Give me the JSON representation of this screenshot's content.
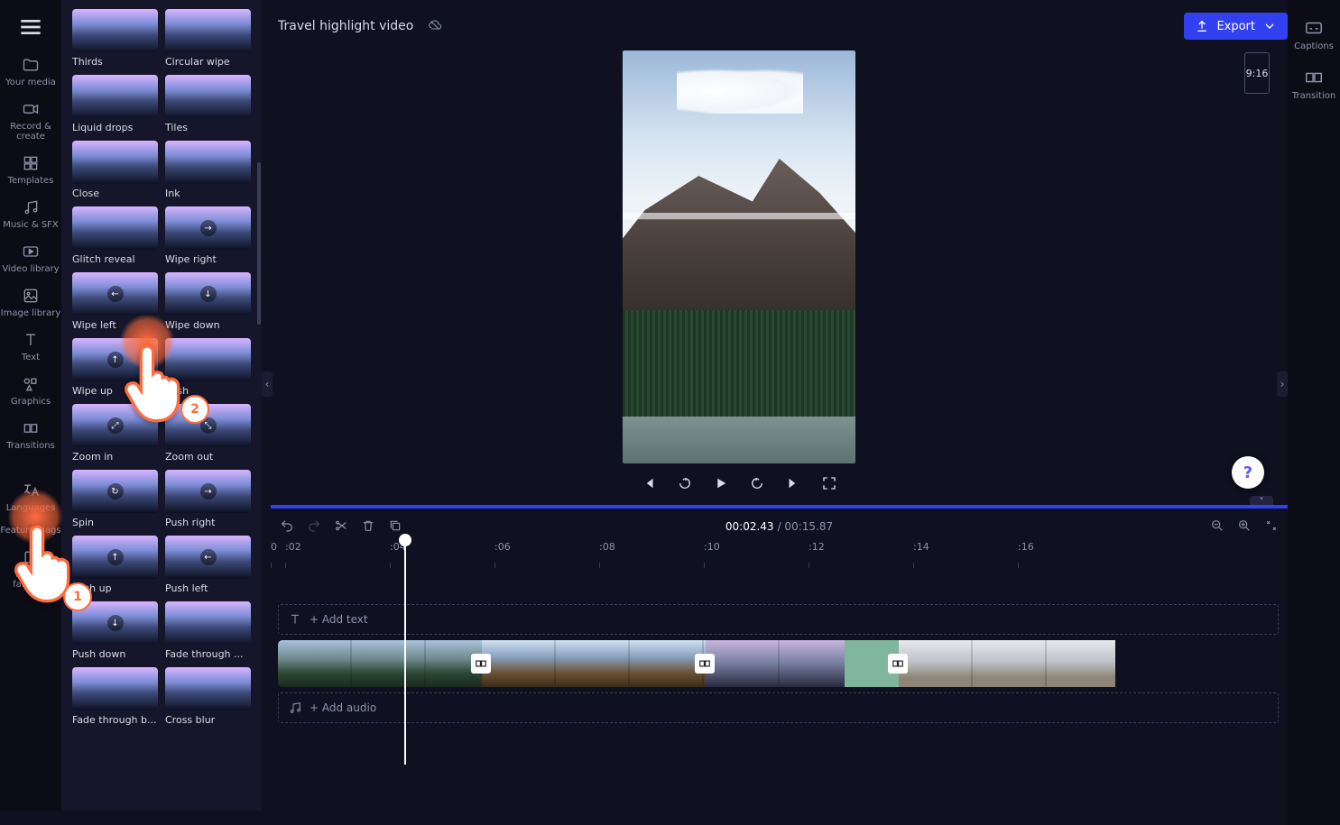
{
  "header": {
    "project_title": "Travel highlight video",
    "export_label": "Export",
    "aspect_ratio": "9:16"
  },
  "left_rail": [
    {
      "id": "your-media",
      "label": "Your media"
    },
    {
      "id": "record-create",
      "label": "Record & create"
    },
    {
      "id": "templates",
      "label": "Templates"
    },
    {
      "id": "music-sfx",
      "label": "Music & SFX"
    },
    {
      "id": "video-library",
      "label": "Video library"
    },
    {
      "id": "image-library",
      "label": "Image library"
    },
    {
      "id": "text",
      "label": "Text"
    },
    {
      "id": "graphics",
      "label": "Graphics"
    },
    {
      "id": "transitions",
      "label": "Transitions"
    },
    {
      "id": "languages",
      "label": "Languages"
    },
    {
      "id": "feature-flags",
      "label": "Feature Flags"
    },
    {
      "id": "version",
      "label": "Version fa9c5c6"
    }
  ],
  "right_rail": [
    {
      "id": "captions",
      "label": "Captions"
    },
    {
      "id": "transition",
      "label": "Transition"
    }
  ],
  "transitions_panel": {
    "items": [
      {
        "label": "Thirds",
        "dir": ""
      },
      {
        "label": "Circular wipe",
        "dir": ""
      },
      {
        "label": "Liquid drops",
        "dir": ""
      },
      {
        "label": "Tiles",
        "dir": ""
      },
      {
        "label": "Close",
        "dir": ""
      },
      {
        "label": "Ink",
        "dir": ""
      },
      {
        "label": "Glitch reveal",
        "dir": ""
      },
      {
        "label": "Wipe right",
        "dir": "→"
      },
      {
        "label": "Wipe left",
        "dir": "←"
      },
      {
        "label": "Wipe down",
        "dir": "↓"
      },
      {
        "label": "Wipe up",
        "dir": "↑"
      },
      {
        "label": "Push",
        "dir": ""
      },
      {
        "label": "Zoom in",
        "dir": "⤢"
      },
      {
        "label": "Zoom out",
        "dir": "⤡"
      },
      {
        "label": "Spin",
        "dir": "↻"
      },
      {
        "label": "Push right",
        "dir": "→"
      },
      {
        "label": "Push up",
        "dir": "↑"
      },
      {
        "label": "Push left",
        "dir": "←"
      },
      {
        "label": "Push down",
        "dir": "↓"
      },
      {
        "label": "Fade through ...",
        "dir": ""
      },
      {
        "label": "Fade through b...",
        "dir": ""
      },
      {
        "label": "Cross blur",
        "dir": ""
      }
    ]
  },
  "timeline": {
    "current_time": "00:02.43",
    "total_time": "00:15.87",
    "add_text": "+ Add text",
    "add_audio": "+ Add audio",
    "ruler": [
      "0",
      ":02",
      ":04",
      ":06",
      ":08",
      ":10",
      ":12",
      ":14",
      ":16"
    ]
  },
  "tutorial": {
    "step1": "1",
    "step2": "2"
  },
  "help": "?"
}
